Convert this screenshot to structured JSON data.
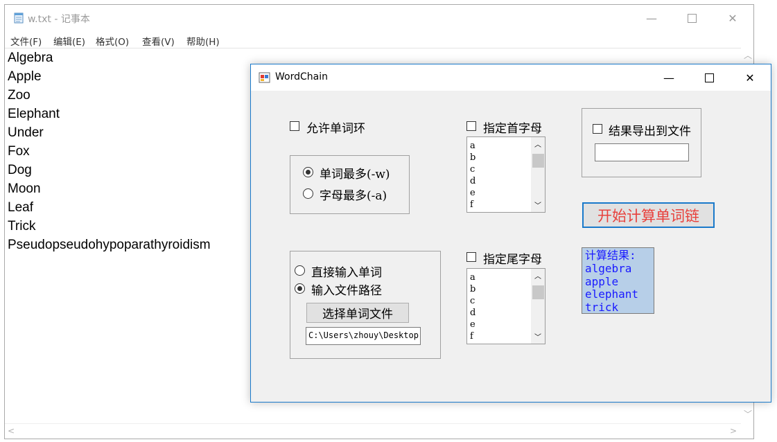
{
  "notepad": {
    "title": "w.txt - 记事本",
    "menu": [
      "文件(F)",
      "编辑(E)",
      "格式(O)",
      "查看(V)",
      "帮助(H)"
    ],
    "lines": [
      "Algebra",
      "Apple",
      "Zoo",
      "Elephant",
      "Under",
      "Fox",
      "Dog",
      "Moon",
      "Leaf",
      "Trick",
      "Pseudopseudohypoparathyroidism"
    ]
  },
  "wordchain": {
    "title": "WordChain",
    "allow_cycle": "允许单词环",
    "mode_group": {
      "max_words": "单词最多(-w)",
      "max_letters": "字母最多(-a)",
      "selected": "max_words"
    },
    "input_group": {
      "direct": "直接输入单词",
      "file_path": "输入文件路径",
      "selected": "file_path",
      "choose_button": "选择单词文件",
      "path_value": "C:\\Users\\zhouy\\Desktop"
    },
    "head_letter": {
      "label": "指定首字母",
      "items": [
        "a",
        "b",
        "c",
        "d",
        "e",
        "f"
      ]
    },
    "tail_letter": {
      "label": "指定尾字母",
      "items": [
        "a",
        "b",
        "c",
        "d",
        "e",
        "f"
      ]
    },
    "export": {
      "label": "结果导出到文件",
      "value": ""
    },
    "compute_button": "开始计算单词链",
    "result": {
      "header": "计算结果:",
      "words": [
        "algebra",
        "apple",
        "elephant",
        "trick"
      ]
    }
  },
  "colors": {
    "accent": "#1979ca",
    "compute_text": "#e8413c",
    "result_bg": "#b7cfe8",
    "result_text": "#1a1aff"
  }
}
